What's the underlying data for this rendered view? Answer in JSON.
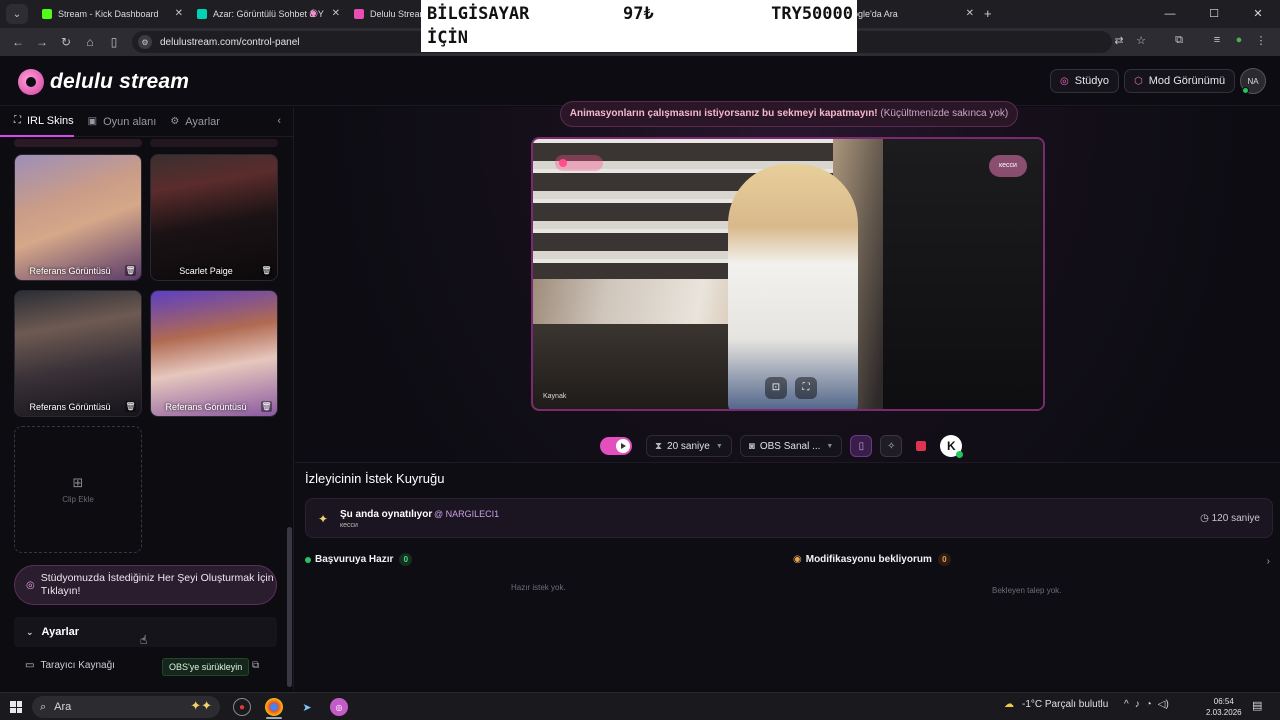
{
  "browser": {
    "tabs": [
      {
        "title": "Stream - Kick Dashboard",
        "color": "#53fc18"
      },
      {
        "title": "Azar: Görüntülü Sohbet & Y",
        "color": "#00d4b4"
      },
      {
        "title": "Delulu Stream",
        "color": "#e94cb3"
      },
      {
        "title": "a - Google'da Ara",
        "color": "#4285f4"
      }
    ],
    "url": "delulustream.com/control-panel",
    "new_tab": "+",
    "window_controls": [
      "—",
      "☐",
      "✕"
    ]
  },
  "overlay": {
    "line1": "BİLGİSAYAR",
    "line2": "İÇİN",
    "price": "97₺",
    "goal": "TRY50000"
  },
  "header": {
    "brand": "delulu stream",
    "studio_button": "Stüdyo",
    "mod_button": "Mod Görünümü",
    "avatar_text": "NA"
  },
  "sidebar": {
    "tabs": [
      {
        "label": "IRL Skins",
        "icon": "frame-icon",
        "active": true
      },
      {
        "label": "Oyun alanı",
        "icon": "gamepad-icon",
        "active": false
      },
      {
        "label": "Ayarlar",
        "icon": "gear-icon",
        "active": false
      }
    ],
    "skins": [
      {
        "label": "Referans Görüntüsü"
      },
      {
        "label": "Scarlet Paige"
      },
      {
        "label": "Referans Görüntüsü"
      },
      {
        "label": "Referans Görüntüsü"
      }
    ],
    "add_clip": "Clip Ekle",
    "studio_prompt": "Stüdyomuzda İstediğiniz Her Şeyi Oluşturmak İçin Tıklayın!",
    "settings_title": "Ayarlar",
    "browser_source": "Tarayıcı Kaynağı",
    "obs_button": "OBS'ye sürükleyin"
  },
  "main": {
    "notice_bold": "Animasyonların çalışmasını istiyorsanız bu sekmeyi kapatmayın!",
    "notice_soft": "(Küçültmenizde sakınca yok)",
    "preview_label": "кесси",
    "source_label": "Kaynak",
    "controls": {
      "duration": "20 saniye",
      "source": "OBS Sanal ..."
    },
    "queue": {
      "title": "İzleyicinin İstek Kuyruğu",
      "now_playing": "Şu anda oynatılıyor",
      "requester": "@ NARGILECI1",
      "item": "кесси",
      "duration": "120 saniye",
      "ready_title": "Başvuruya Hazır",
      "ready_count": "0",
      "ready_empty": "Hazır istek yok.",
      "pending_title": "Modifikasyonu bekliyorum",
      "pending_count": "0",
      "pending_empty": "Bekleyen talep yok."
    }
  },
  "taskbar": {
    "search": "Ara",
    "weather": "-1°C  Parçalı bulutlu",
    "time": "06:54",
    "date": "2.03.2026"
  }
}
